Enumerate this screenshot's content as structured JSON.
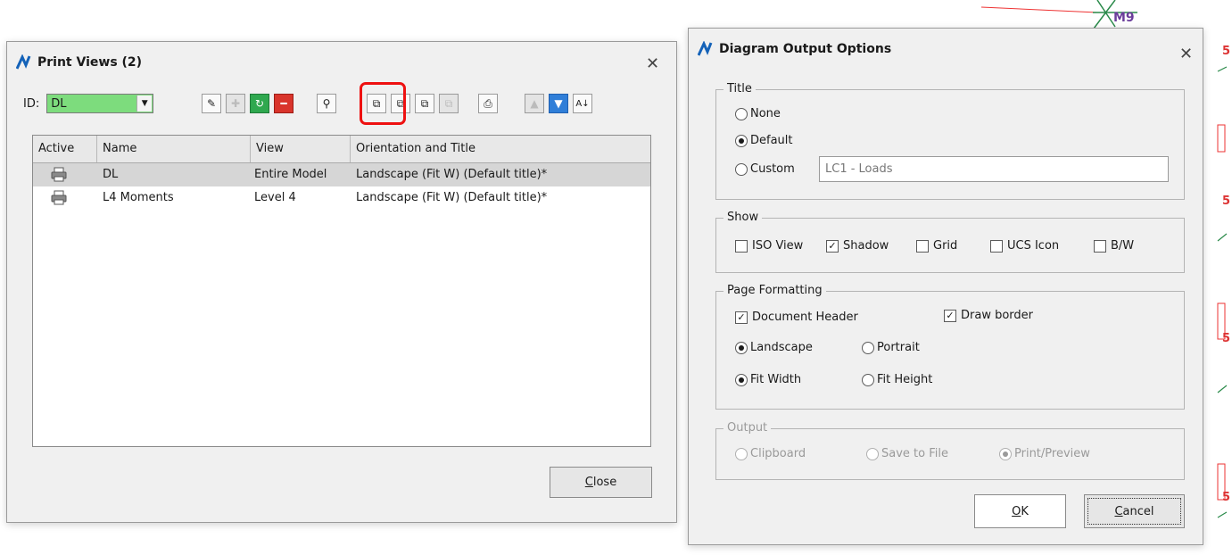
{
  "background": {
    "node_labels": [
      "M9",
      "5",
      "5",
      "5",
      "5"
    ]
  },
  "print_views": {
    "title": "Print Views (2)",
    "id_label": "ID:",
    "id_value": "DL",
    "columns": [
      "Active",
      "Name",
      "View",
      "Orientation and Title"
    ],
    "rows": [
      {
        "name": "DL",
        "view": "Entire Model",
        "orientation": "Landscape (Fit W) (Default title)*",
        "selected": true
      },
      {
        "name": "L4 Moments",
        "view": "Level 4",
        "orientation": "Landscape (Fit W) (Default title)*",
        "selected": false
      }
    ],
    "close_label": "Close",
    "close_underline": "C",
    "close_rest": "lose"
  },
  "diagram": {
    "title": "Diagram Output Options",
    "title_group": {
      "label": "Title",
      "none": "None",
      "default": "Default",
      "custom": "Custom",
      "custom_value": "LC1 - Loads",
      "selected": "Default"
    },
    "show_group": {
      "label": "Show",
      "iso_view": "ISO View",
      "shadow": "Shadow",
      "grid": "Grid",
      "ucs_icon": "UCS Icon",
      "bw": "B/W"
    },
    "page_group": {
      "label": "Page Formatting",
      "document_header": "Document Header",
      "draw_border": "Draw border",
      "landscape": "Landscape",
      "portrait": "Portrait",
      "fit_width": "Fit Width",
      "fit_height": "Fit Height"
    },
    "output_group": {
      "label": "Output",
      "clipboard": "Clipboard",
      "save_to_file": "Save to File",
      "print_preview": "Print/Preview"
    },
    "ok_underline": "O",
    "ok_rest": "K",
    "cancel_underline": "C",
    "cancel_rest": "ancel"
  },
  "colors": {
    "id_combo_bg": "#7ddc7d",
    "highlight": "#e11111",
    "selected_row": "#d6d6d6"
  }
}
